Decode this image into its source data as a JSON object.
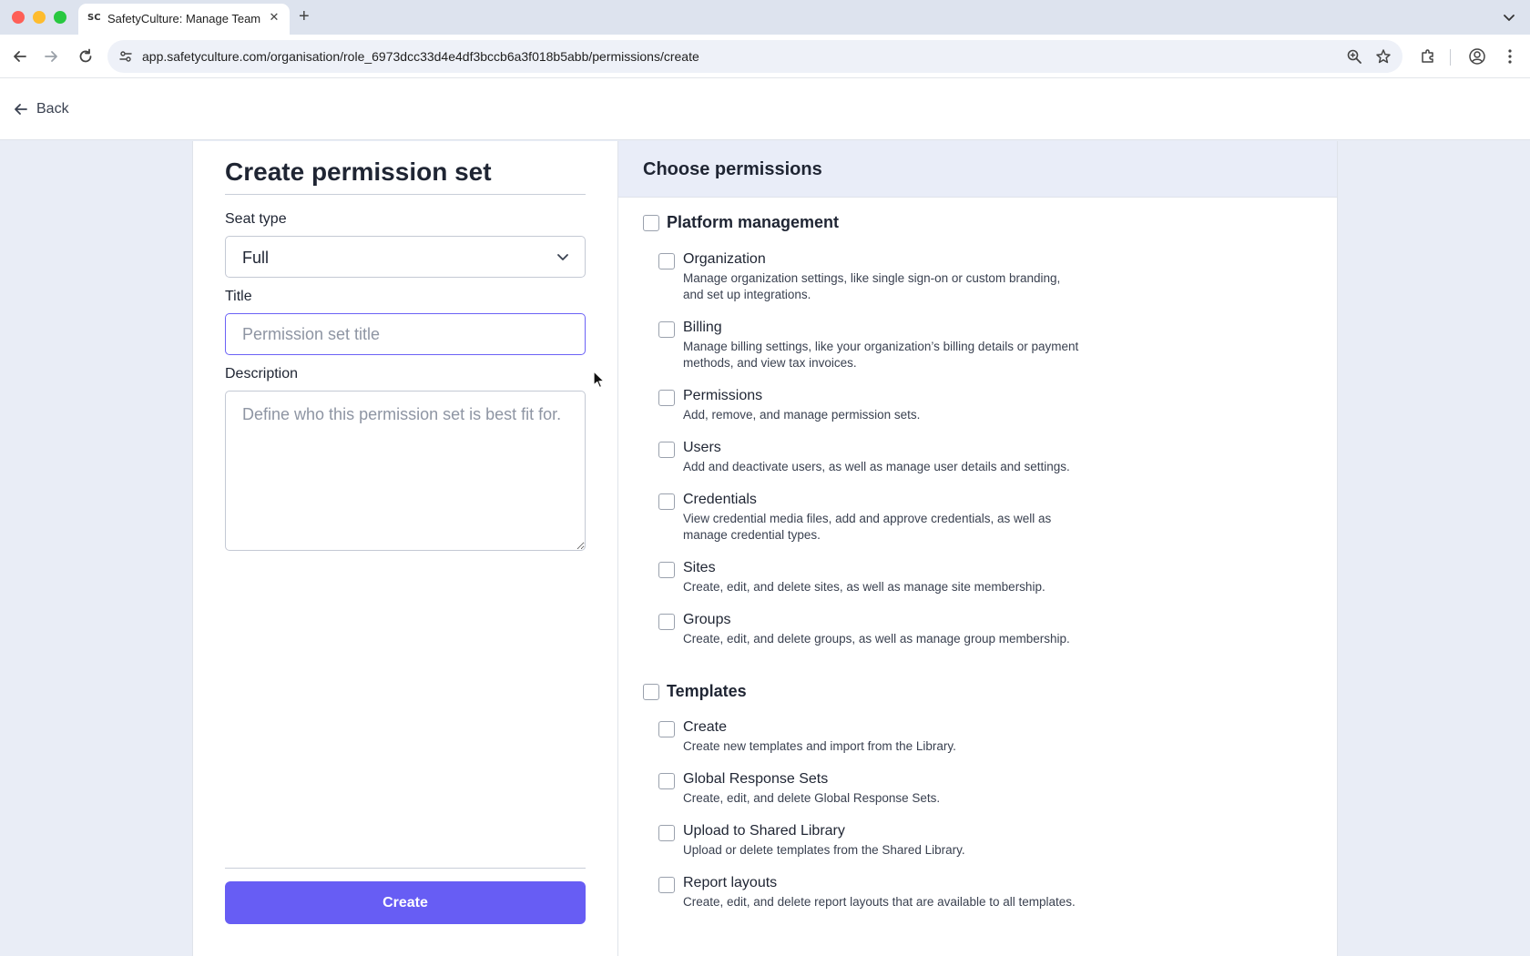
{
  "browser": {
    "tab_title": "SafetyCulture: Manage Teams",
    "favicon_text": "SC",
    "url": "app.safetyculture.com/organisation/role_6973dcc33d4e4df3bccb6a3f018b5abb/permissions/create"
  },
  "header": {
    "back_label": "Back"
  },
  "form": {
    "heading": "Create permission set",
    "seat_type_label": "Seat type",
    "seat_type_value": "Full",
    "title_label": "Title",
    "title_placeholder": "Permission set title",
    "title_value": "",
    "description_label": "Description",
    "description_placeholder": "Define who this permission set is best fit for.",
    "create_label": "Create"
  },
  "permissions": {
    "heading": "Choose permissions",
    "groups": [
      {
        "label": "Platform management",
        "checked": false,
        "items": [
          {
            "name": "Organization",
            "desc": "Manage organization settings, like single sign-on or custom branding, and set up integrations.",
            "checked": false
          },
          {
            "name": "Billing",
            "desc": "Manage billing settings, like your organization’s billing details or payment methods, and view tax invoices.",
            "checked": false
          },
          {
            "name": "Permissions",
            "desc": "Add, remove, and manage permission sets.",
            "checked": false
          },
          {
            "name": "Users",
            "desc": "Add and deactivate users, as well as manage user details and settings.",
            "checked": false
          },
          {
            "name": "Credentials",
            "desc": "View credential media files, add and approve credentials, as well as manage credential types.",
            "checked": false
          },
          {
            "name": "Sites",
            "desc": "Create, edit, and delete sites, as well as manage site membership.",
            "checked": false
          },
          {
            "name": "Groups",
            "desc": "Create, edit, and delete groups, as well as manage group membership.",
            "checked": false
          }
        ]
      },
      {
        "label": "Templates",
        "checked": false,
        "items": [
          {
            "name": "Create",
            "desc": "Create new templates and import from the Library.",
            "checked": false
          },
          {
            "name": "Global Response Sets",
            "desc": "Create, edit, and delete Global Response Sets.",
            "checked": false
          },
          {
            "name": "Upload to Shared Library",
            "desc": "Upload or delete templates from the Shared Library.",
            "checked": false
          },
          {
            "name": "Report layouts",
            "desc": "Create, edit, and delete report layouts that are available to all templates.",
            "checked": false
          }
        ]
      }
    ]
  },
  "colors": {
    "primary": "#675df4",
    "input_focus_border": "#6b62f6",
    "panel_header_bg": "#e9edf8",
    "page_bg": "#e9edf6"
  },
  "icons": [
    "close-icon",
    "plus-icon",
    "back-arrow-icon",
    "forward-arrow-icon",
    "reload-icon",
    "site-info-icon",
    "zoom-icon",
    "star-icon",
    "extensions-icon",
    "profile-icon",
    "more-icon",
    "chevron-down-icon",
    "arrow-left-icon",
    "mouse-cursor-icon"
  ]
}
